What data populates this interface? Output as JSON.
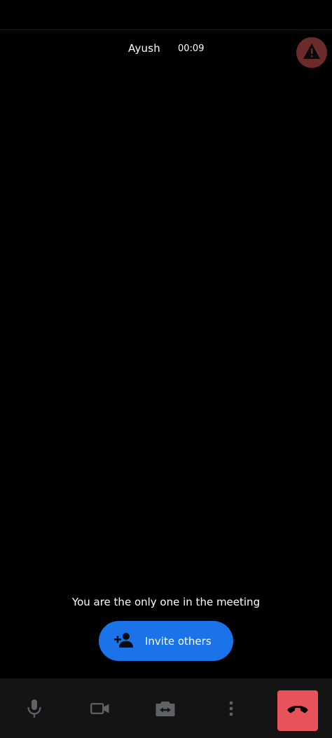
{
  "call": {
    "participant_name": "Ayush",
    "elapsed_time": "00:09"
  },
  "main": {
    "only_one_message": "You are the only one in the meeting",
    "invite_label": "Invite others"
  },
  "controls": {
    "items": [
      {
        "icon": "microphone-icon"
      },
      {
        "icon": "video-camera-icon"
      },
      {
        "icon": "switch-camera-icon"
      },
      {
        "icon": "more-options-icon"
      },
      {
        "icon": "end-call-icon"
      }
    ]
  },
  "colors": {
    "background": "#000000",
    "accent_blue": "#1a73e8",
    "end_call_red": "#e8535a",
    "warning_bg": "#6b2b2b",
    "icon_gray": "#5f6368"
  }
}
